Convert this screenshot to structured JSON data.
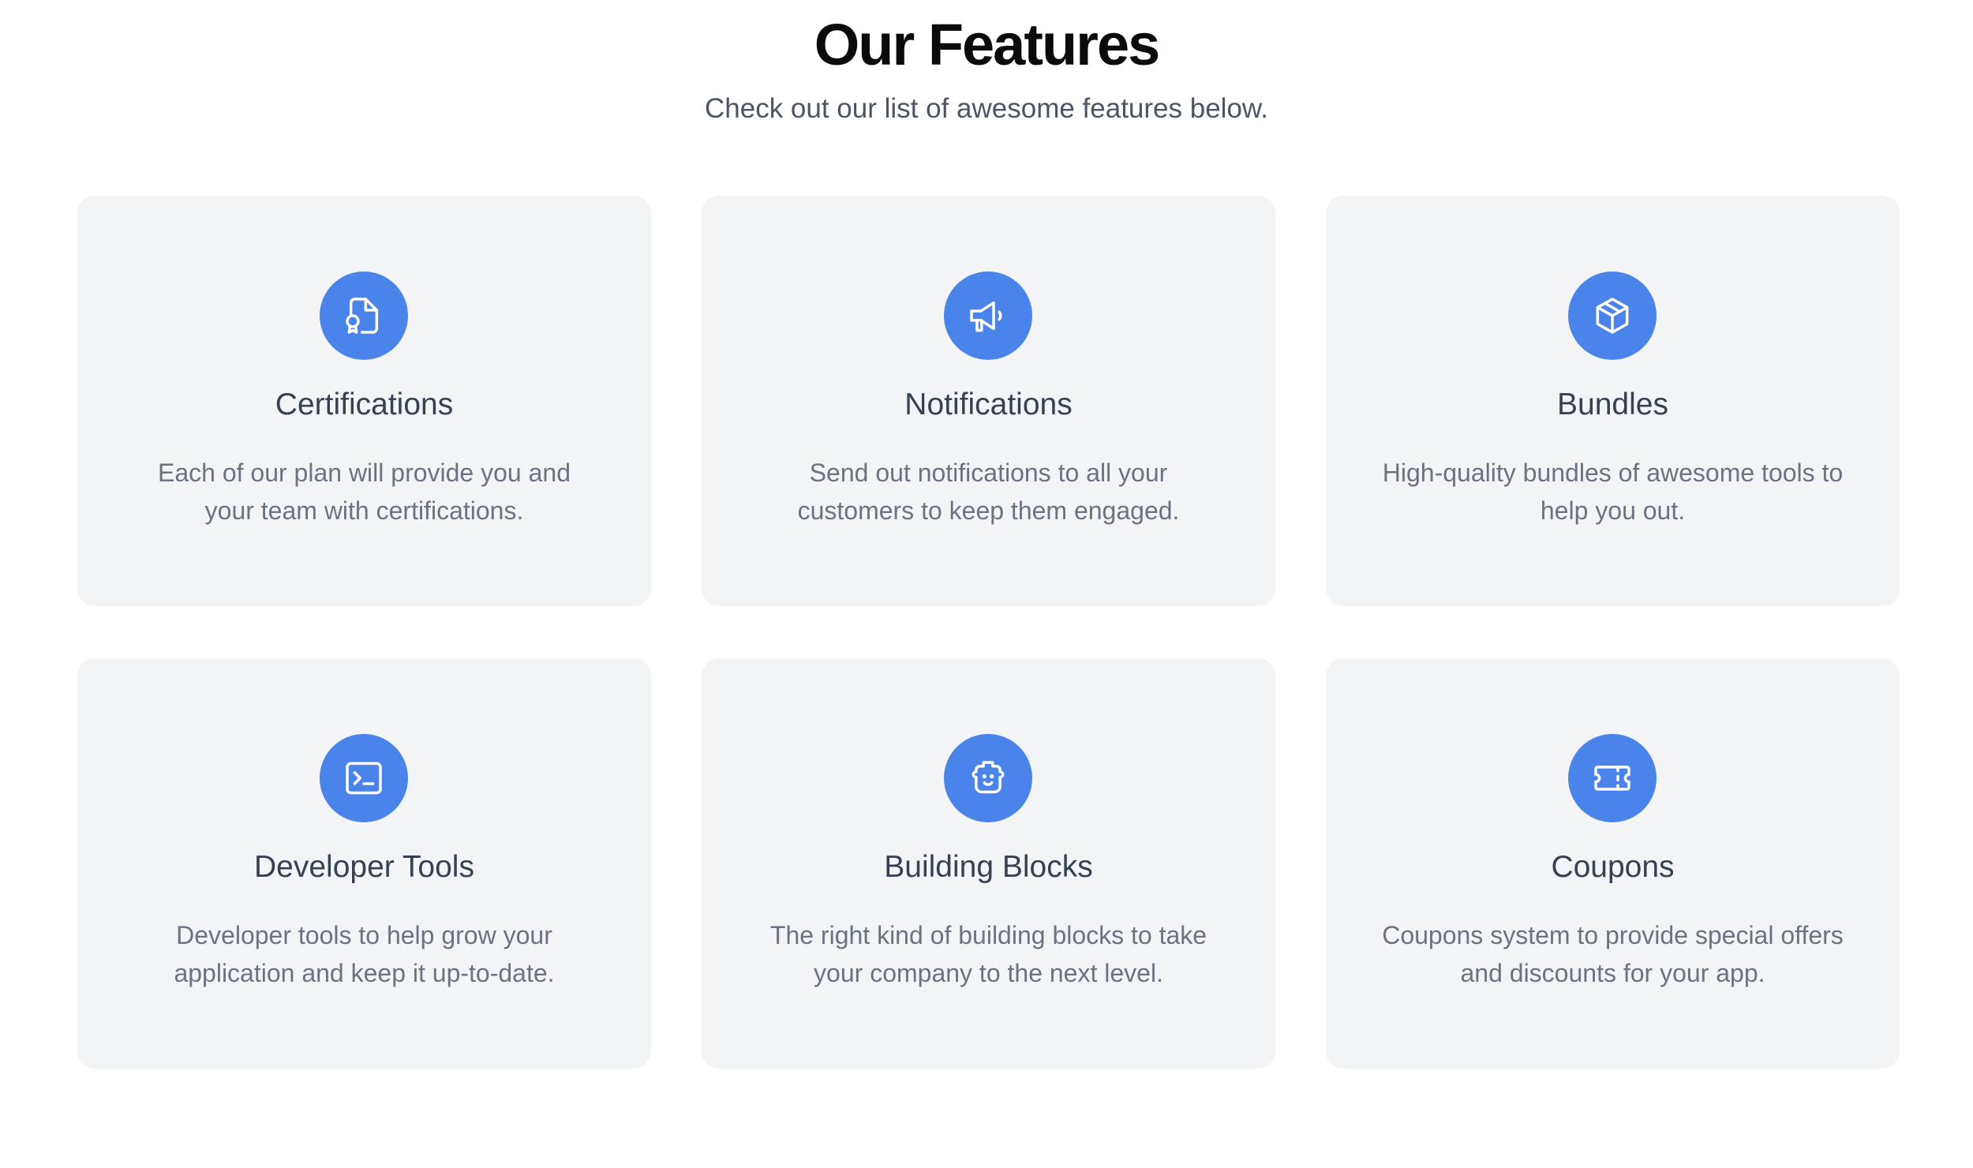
{
  "header": {
    "title": "Our Features",
    "subtitle": "Check out our list of awesome features below."
  },
  "colors": {
    "accent": "#4a84ea",
    "card_bg": "#f3f4f6",
    "title": "#0b0b0b",
    "text": "#374151",
    "muted": "#6b7280"
  },
  "features": [
    {
      "title": "Certifications",
      "description": "Each of our plan will provide you and your team with certifications.",
      "icon": "certificate-icon"
    },
    {
      "title": "Notifications",
      "description": "Send out notifications to all your customers to keep them engaged.",
      "icon": "megaphone-icon"
    },
    {
      "title": "Bundles",
      "description": "High-quality bundles of awesome tools to help you out.",
      "icon": "box-icon"
    },
    {
      "title": "Developer Tools",
      "description": "Developer tools to help grow your application and keep it up-to-date.",
      "icon": "terminal-icon"
    },
    {
      "title": "Building Blocks",
      "description": "The right kind of building blocks to take your company to the next level.",
      "icon": "lego-block-icon"
    },
    {
      "title": "Coupons",
      "description": "Coupons system to provide special offers and discounts for your app.",
      "icon": "ticket-icon"
    }
  ]
}
